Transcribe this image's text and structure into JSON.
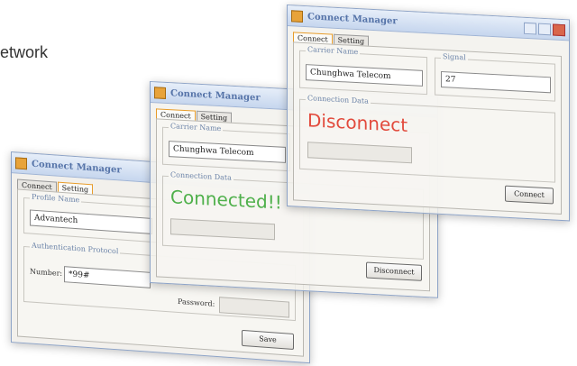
{
  "page": {
    "partial_text": "etwork"
  },
  "win1": {
    "title": "Connect Manager",
    "tabs": [
      "Connect",
      "Setting"
    ],
    "profile_group": "Profile Name",
    "profile_value": "Advantech",
    "auth_group": "Authentication Protocol",
    "number_label": "Number:",
    "number_value": "*99#",
    "password_label": "Password:",
    "save_label": "Save"
  },
  "win2": {
    "title": "Connect Manager",
    "tabs": [
      "Connect",
      "Setting"
    ],
    "carrier_group": "Carrier Name",
    "carrier_value": "Chunghwa Telecom",
    "connection_group": "Connection Data",
    "status": "Connected!!",
    "disconnect_label": "Disconnect",
    "status_color": "#4fb04b"
  },
  "win3": {
    "title": "Connect Manager",
    "tabs": [
      "Connect",
      "Setting"
    ],
    "carrier_group": "Carrier Name",
    "carrier_value": "Chunghwa Telecom",
    "signal_group": "Signal",
    "signal_value": "27",
    "connection_group": "Connection Data",
    "status": "Disconnect",
    "connect_label": "Connect",
    "status_color": "#e24a3c"
  }
}
